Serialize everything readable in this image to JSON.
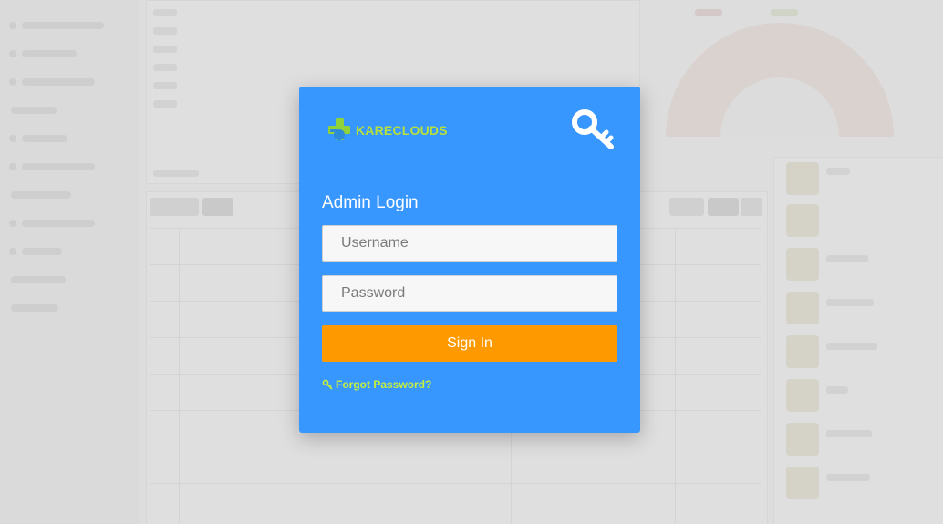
{
  "brand": {
    "name": "KARECLOUDS",
    "text_color": "#b7e03b",
    "mark_colors": [
      "#8fd23a",
      "#2d8bd8"
    ]
  },
  "header": {
    "icon": "key-icon"
  },
  "login": {
    "title": "Admin Login",
    "username_placeholder": "Username",
    "password_placeholder": "Password",
    "signin_label": "Sign In",
    "forgot_label": "Forgot Password?",
    "forgot_icon": "small-key-icon"
  },
  "colors": {
    "modal_bg": "#3797ff",
    "button_bg": "#ff9900",
    "link": "#c6ef3c"
  }
}
